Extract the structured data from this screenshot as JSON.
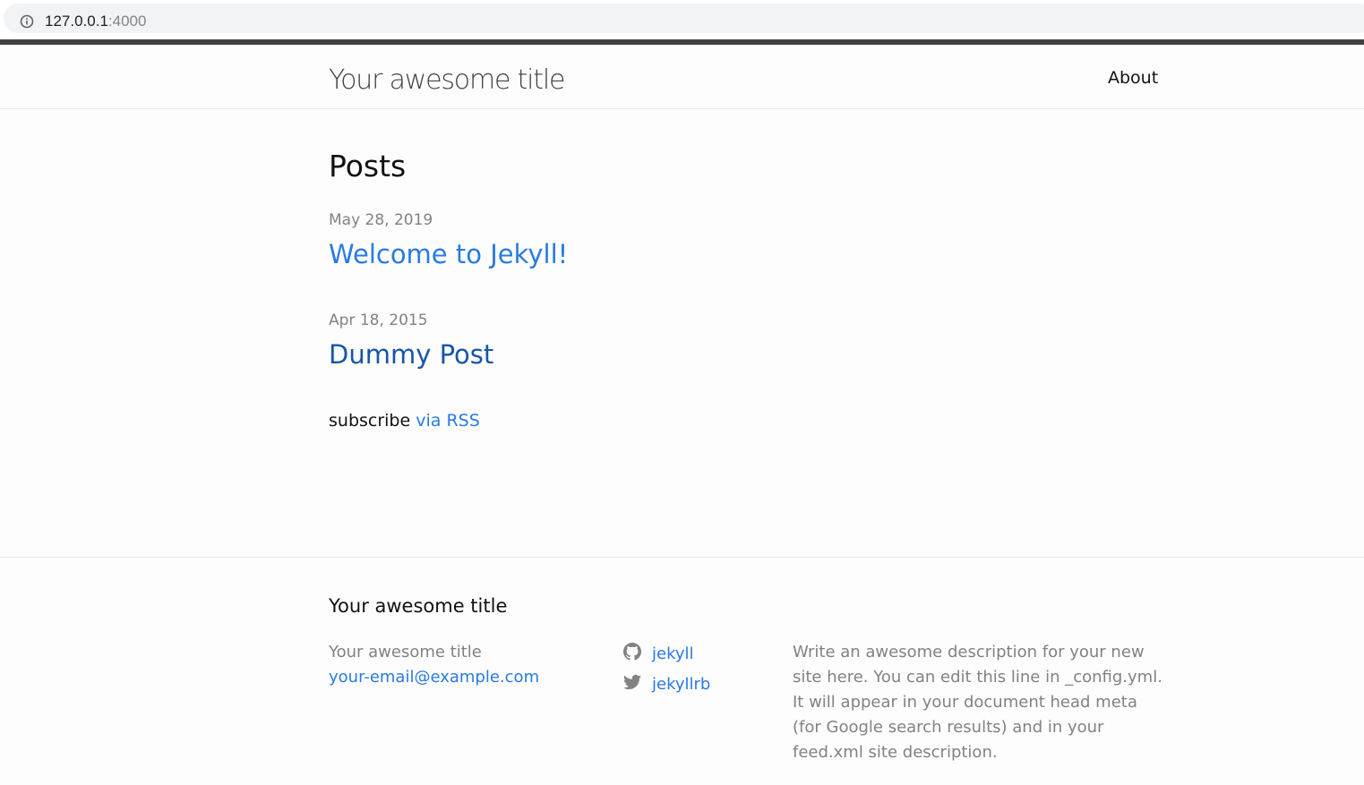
{
  "browser": {
    "url_host": "127.0.0.1",
    "url_port": ":4000"
  },
  "header": {
    "site_title": "Your awesome title",
    "nav": [
      {
        "label": "About"
      }
    ]
  },
  "main": {
    "heading": "Posts",
    "posts": [
      {
        "date": "May 28, 2019",
        "title": "Welcome to Jekyll!",
        "color": "#2a7ae2"
      },
      {
        "date": "Apr 18, 2015",
        "title": "Dummy Post",
        "color": "#1756a9"
      }
    ],
    "subscribe_text": "subscribe",
    "subscribe_link": "via RSS"
  },
  "footer": {
    "heading": "Your awesome title",
    "name": "Your awesome title",
    "email": "your-email@example.com",
    "social": [
      {
        "icon": "github-icon",
        "label": "jekyll"
      },
      {
        "icon": "twitter-icon",
        "label": "jekyllrb"
      }
    ],
    "description": "Write an awesome description for your new site here. You can edit this line in _config.yml. It will appear in your document head meta (for Google search results) and in your feed.xml site description."
  },
  "colors": {
    "link": "#2a7ae2",
    "visited_link": "#1756a9",
    "meta_grey": "#828282",
    "header_border": "#424242"
  }
}
